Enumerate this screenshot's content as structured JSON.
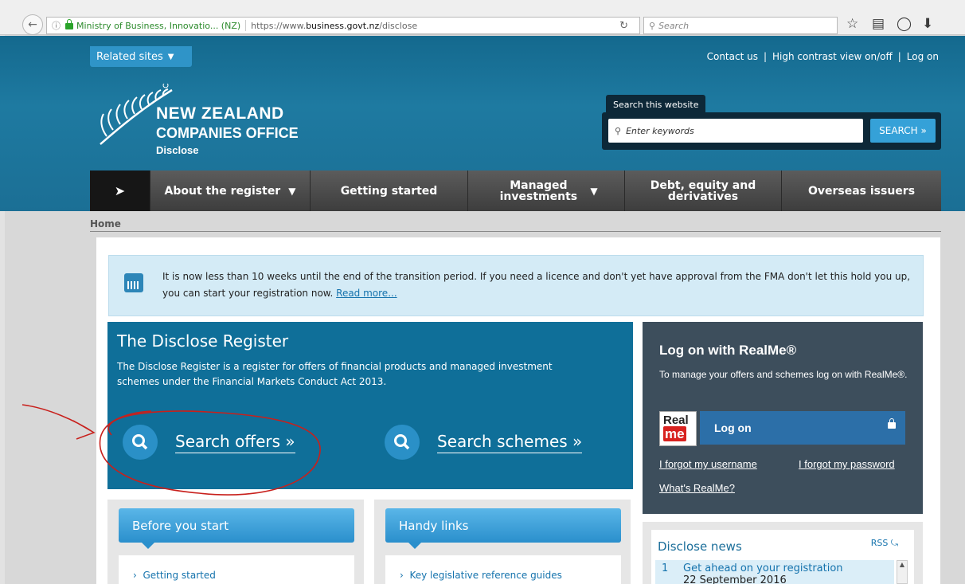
{
  "browser": {
    "site_identity": "Ministry of Business, Innovatio... (NZ)",
    "url_prefix": "https://www.",
    "url_domain": "business.govt.nz",
    "url_path": "/disclose",
    "search_placeholder": "Search"
  },
  "header": {
    "related_sites": "Related sites",
    "top_links": [
      "Contact us",
      "High contrast view on/off",
      "Log on"
    ],
    "logo_line1": "NEW ZEALAND",
    "logo_line2": "COMPANIES OFFICE",
    "logo_line3": "Disclose",
    "search_tab": "Search this website",
    "search_placeholder": "Enter keywords",
    "search_button": "SEARCH »"
  },
  "nav": {
    "items": [
      {
        "label": "About the register"
      },
      {
        "label": "Getting started"
      },
      {
        "label": "Managed investments"
      },
      {
        "label": "Debt, equity and derivatives"
      },
      {
        "label": "Overseas issuers"
      }
    ]
  },
  "breadcrumb": "Home",
  "alert": {
    "text": "It is now less than 10 weeks until the end of the transition period. If you need a licence and don't yet have approval from the FMA don't let this hold you up, you can start your registration now. ",
    "link": "Read more..."
  },
  "register": {
    "title": "The Disclose Register",
    "description": "The Disclose Register is a register for offers of financial products and managed investment schemes under the Financial Markets Conduct Act 2013.",
    "search_offers": "Search offers »",
    "search_schemes": "Search schemes »"
  },
  "realme": {
    "title": "Log on with RealMe®",
    "description": "To manage your offers and schemes log on with RealMe®.",
    "logo_top": "Real",
    "logo_bottom": "me",
    "login_button": "Log on",
    "forgot_username": "I forgot my username",
    "forgot_password": "I forgot my password",
    "whats_realme": "What's RealMe?"
  },
  "panels": {
    "before_title": "Before you start",
    "before_item": "Getting started",
    "handy_title": "Handy links",
    "handy_item": "Key legislative reference guides"
  },
  "news": {
    "title": "Disclose news",
    "rss": "RSS",
    "item_number": "1",
    "item_title": "Get ahead on your registration",
    "item_date": "22 September 2016"
  },
  "colors": {
    "header_blue": "#1e7aa1",
    "accent_blue": "#2a90c7",
    "annotation_red": "#c8201c"
  }
}
